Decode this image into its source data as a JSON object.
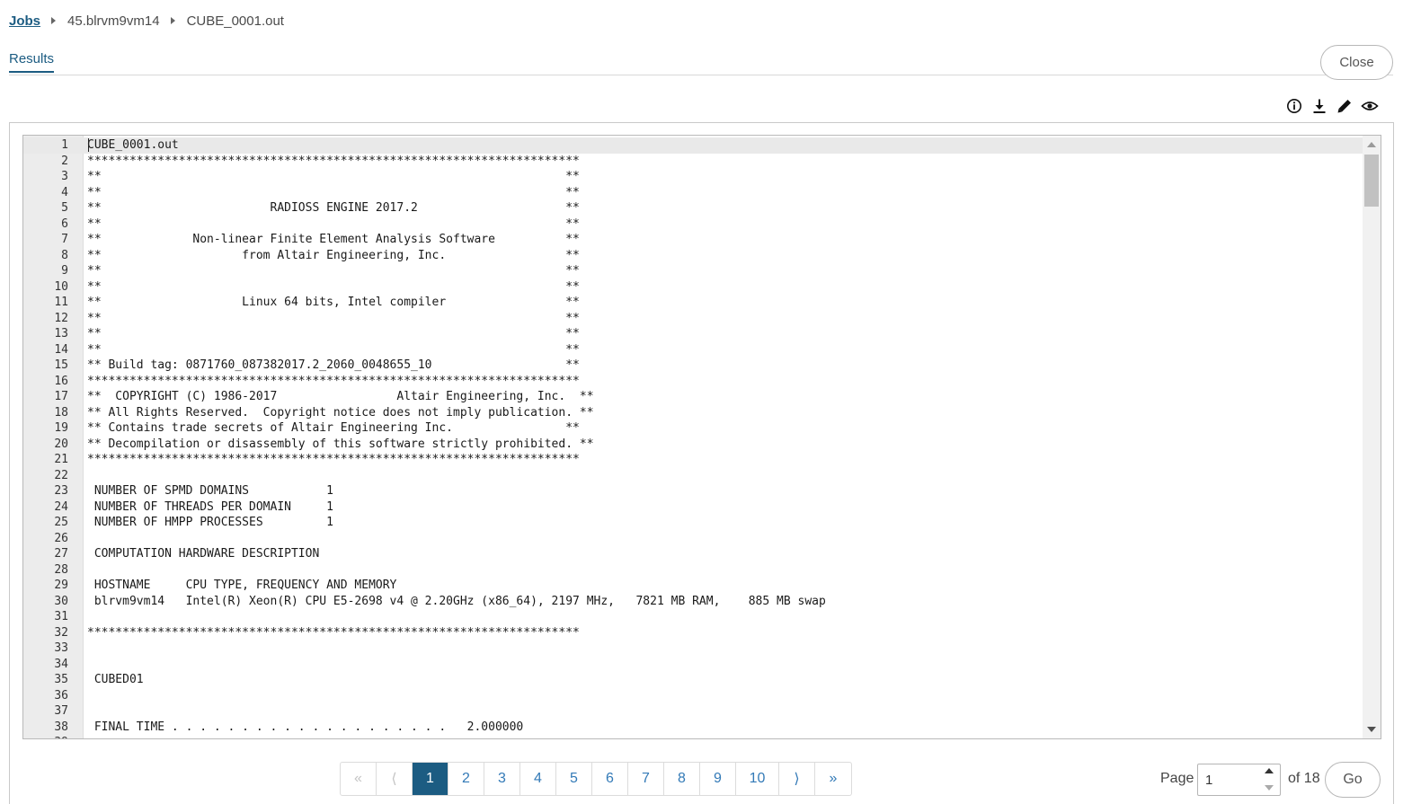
{
  "breadcrumb": {
    "root": "Jobs",
    "job": "45.blrvm9vm14",
    "file": "CUBE_0001.out"
  },
  "tabs": {
    "results": "Results"
  },
  "actions": {
    "close": "Close"
  },
  "toolbar": {
    "icons": [
      "info-icon",
      "download-icon",
      "edit-icon",
      "view-icon"
    ]
  },
  "editor": {
    "lines": [
      "CUBE_0001.out",
      "**********************************************************************",
      "**                                                                  **",
      "**                                                                  **",
      "**                        RADIOSS ENGINE 2017.2                     **",
      "**                                                                  **",
      "**             Non-linear Finite Element Analysis Software          **",
      "**                    from Altair Engineering, Inc.                 **",
      "**                                                                  **",
      "**                                                                  **",
      "**                    Linux 64 bits, Intel compiler                 **",
      "**                                                                  **",
      "**                                                                  **",
      "**                                                                  **",
      "** Build tag: 0871760_087382017.2_2060_0048655_10                   **",
      "**********************************************************************",
      "**  COPYRIGHT (C) 1986-2017                 Altair Engineering, Inc.  **",
      "** All Rights Reserved.  Copyright notice does not imply publication. **",
      "** Contains trade secrets of Altair Engineering Inc.                **",
      "** Decompilation or disassembly of this software strictly prohibited. **",
      "**********************************************************************",
      "",
      " NUMBER OF SPMD DOMAINS           1",
      " NUMBER OF THREADS PER DOMAIN     1",
      " NUMBER OF HMPP PROCESSES         1",
      "",
      " COMPUTATION HARDWARE DESCRIPTION",
      "",
      " HOSTNAME     CPU TYPE, FREQUENCY AND MEMORY",
      " blrvm9vm14   Intel(R) Xeon(R) CPU E5-2698 v4 @ 2.20GHz (x86_64), 2197 MHz,   7821 MB RAM,    885 MB swap",
      "",
      "**********************************************************************",
      "",
      "",
      " CUBED01",
      "",
      "",
      " FINAL TIME . . . . . . . . . . . . . . . . . . . .   2.000000"
    ]
  },
  "pagination": {
    "first": "«",
    "prev": "⟨",
    "pages": [
      "1",
      "2",
      "3",
      "4",
      "5",
      "6",
      "7",
      "8",
      "9",
      "10"
    ],
    "current": 1,
    "next": "⟩",
    "last": "»",
    "page_label": "Page",
    "page_value": "1",
    "of_label": "of 18",
    "go": "Go"
  },
  "colors": {
    "accent": "#1c5c82",
    "link": "#337ab7"
  }
}
